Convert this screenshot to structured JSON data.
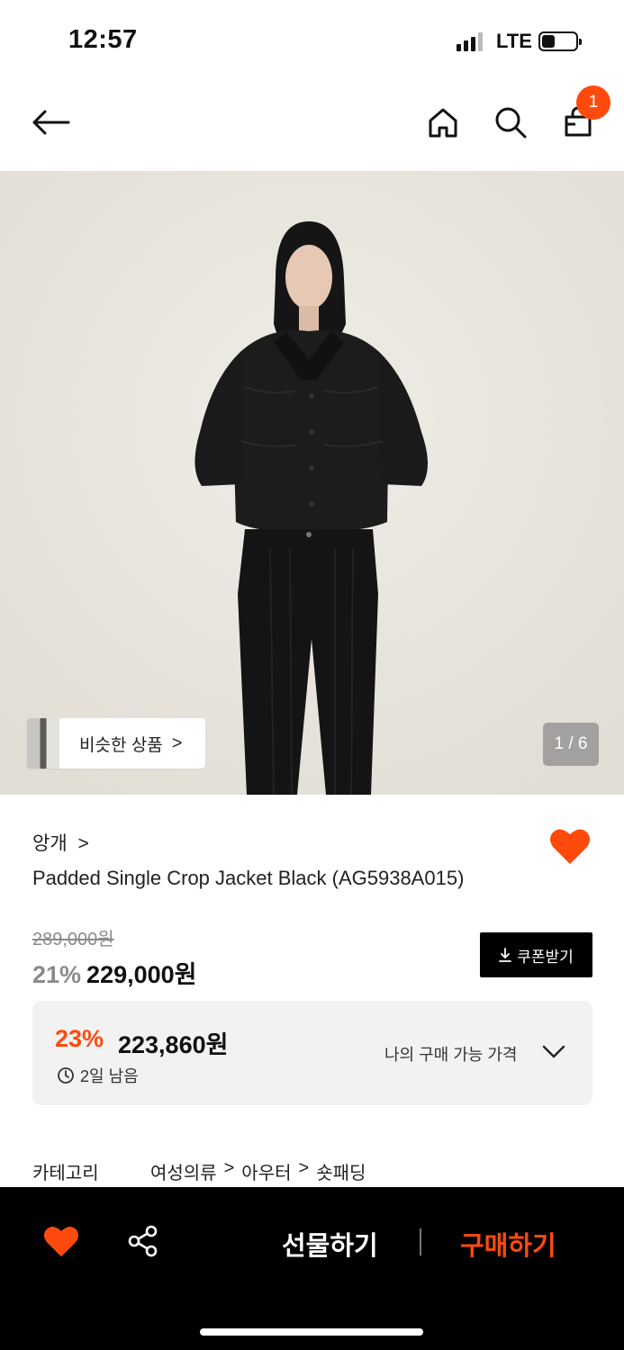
{
  "status_bar": {
    "time": "12:57",
    "network": "LTE"
  },
  "header": {
    "cart_count": "1",
    "icons": [
      "back-arrow-icon",
      "home-icon",
      "search-icon",
      "shopping-bag-icon"
    ]
  },
  "hero": {
    "similar_label": "비슷한 상품",
    "chevron": ">",
    "page_indicator": "1 / 6"
  },
  "product": {
    "brand": "앙개",
    "brand_chevron": ">",
    "name": "Padded Single Crop Jacket Black (AG5938A015)",
    "original_price": "289,000원",
    "discount_pct": "21%",
    "sale_price": "229,000원",
    "coupon_label": "쿠폰받기"
  },
  "my_price": {
    "discount_pct": "23%",
    "price": "223,860원",
    "time_left": "2일 남음",
    "link_label": "나의 구매 가능 가격"
  },
  "category": {
    "label": "카테고리",
    "path": [
      "여성의류",
      ">",
      "아우터",
      ">",
      "숏패딩"
    ]
  },
  "bottom_bar": {
    "gift_label": "선물하기",
    "buy_label": "구매하기"
  },
  "colors": {
    "accent": "#ff4a0d",
    "dark": "#000000",
    "muted": "#8a8a8a",
    "box_bg": "#f2f2f2"
  }
}
